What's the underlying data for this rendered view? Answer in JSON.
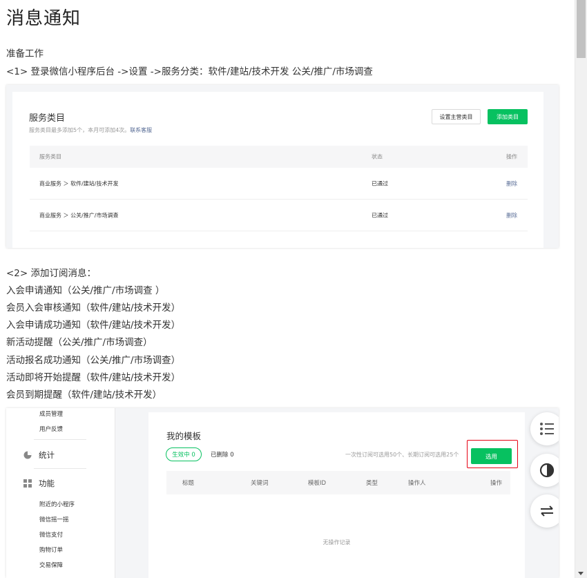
{
  "page": {
    "title": "消息通知",
    "prep_heading": "准备工作",
    "step1": "<1> 登录微信小程序后台 ->设置 ->服务分类：软件/建站/技术开发 公关/推广/市场调查",
    "step2_heading": "<2> 添加订阅消息：",
    "messages": [
      "入会申请通知（公关/推广/市场调查 ）",
      "会员入会审核通知（软件/建站/技术开发）",
      "入会申请成功通知（软件/建站/技术开发）",
      "新活动提醒（公关/推广/市场调查）",
      "活动报名成功通知（公关/推广/市场调查）",
      "活动即将开始提醒（软件/建站/技术开发）",
      "会员到期提醒（软件/建站/技术开发）"
    ]
  },
  "service_categories": {
    "title": "服务类目",
    "subtitle": "服务类目最多添加5个，本月可添加4次。",
    "contact_link": "联系客服",
    "set_primary_button": "设置主营类目",
    "add_button": "添加类目",
    "columns": [
      "服务类目",
      "状态",
      "操作"
    ],
    "rows": [
      {
        "category": "商业服务 ＞ 软件/建站/技术开发",
        "status": "已通过",
        "action": "删除"
      },
      {
        "category": "商业服务 ＞ 公关/推广/市场调查",
        "status": "已通过",
        "action": "删除"
      }
    ]
  },
  "sidebar": {
    "sub_items_top": [
      "成员管理",
      "用户反馈"
    ],
    "group_stats": "统计",
    "group_features": "功能",
    "feature_items": [
      "附近的小程序",
      "微信摇一摇",
      "微信支付",
      "购物订单",
      "交易保障"
    ]
  },
  "templates": {
    "title": "我的模板",
    "active_label": "生效中 0",
    "deleted_label": "已删除  0",
    "limit_text": "一次性订阅可选用50个、长期订阅可选用25个",
    "apply_button": "选用",
    "columns": [
      "标题",
      "关键词",
      "模板ID",
      "类型",
      "操作人",
      "操作"
    ],
    "empty_text": "无操作记录"
  },
  "floating_tools": [
    "list-icon",
    "contrast-icon",
    "swap-icon"
  ],
  "colors": {
    "brand_green": "#07c160",
    "link_blue": "#576b95",
    "highlight_red": "#e60012"
  }
}
